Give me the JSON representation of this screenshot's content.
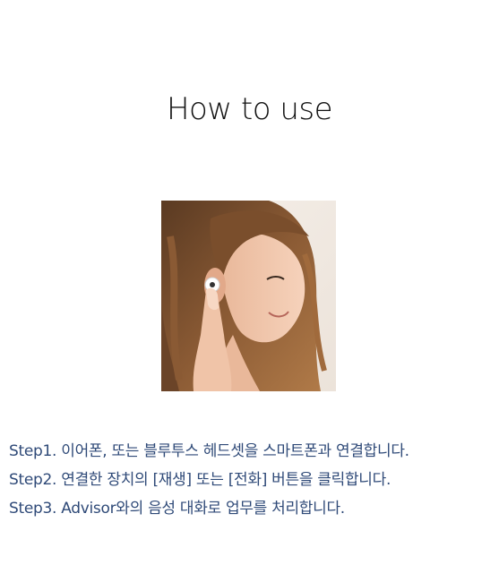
{
  "title": "How to use",
  "photo": {
    "description_icon": "woman-with-earbud-photo"
  },
  "steps": [
    "Step1. 이어폰, 또는 블루투스 헤드셋을 스마트폰과 연결합니다.",
    "Step2. 연결한 장치의 [재생] 또는 [전화] 버튼을 클릭합니다.",
    "Step3. Advisor와의 음성 대화로 업무를 처리합니다."
  ],
  "colors": {
    "step_text": "#2f4a78",
    "title_text": "#111111",
    "background": "#ffffff"
  }
}
